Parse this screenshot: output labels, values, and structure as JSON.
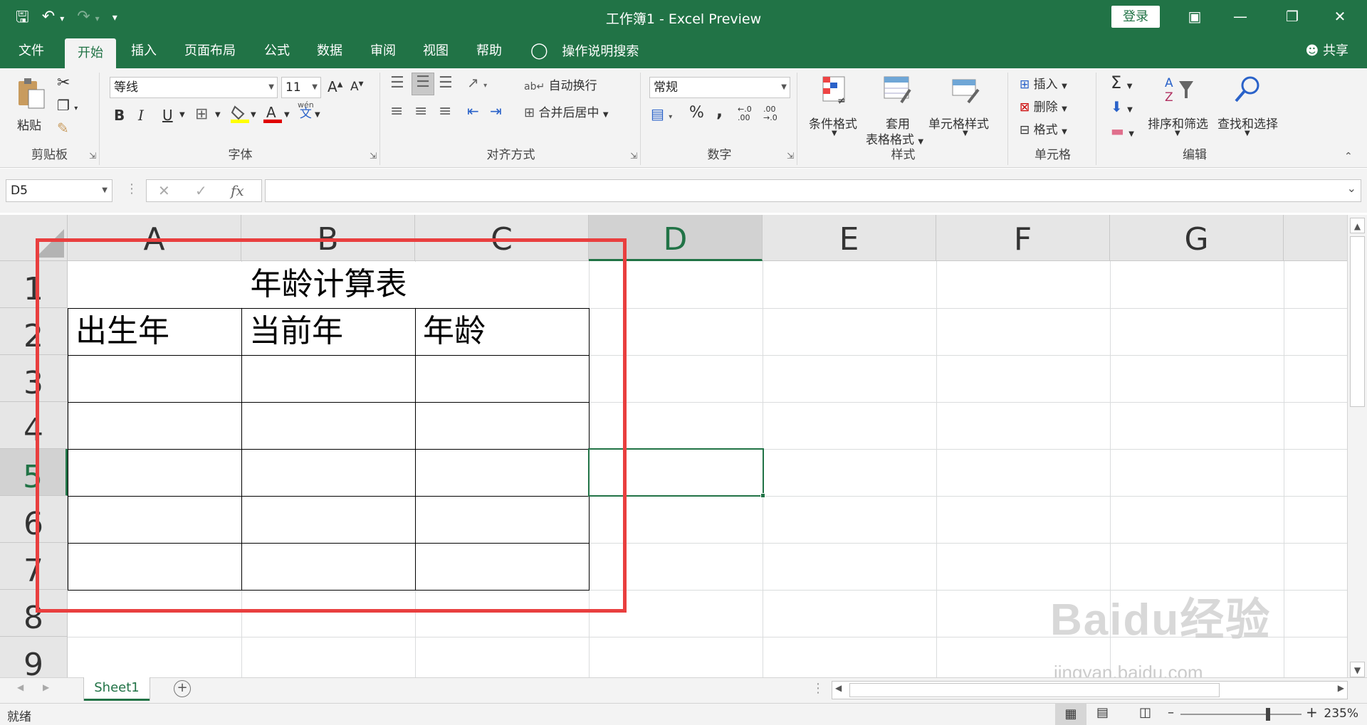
{
  "titlebar": {
    "title": "工作簿1  -  Excel Preview",
    "login": "登录",
    "save_icon": "save-icon",
    "undo_icon": "undo-icon",
    "redo_icon": "redo-icon"
  },
  "tabs": {
    "items": [
      "文件",
      "开始",
      "插入",
      "页面布局",
      "公式",
      "数据",
      "审阅",
      "视图",
      "帮助"
    ],
    "tell_me": "操作说明搜索",
    "share": "共享"
  },
  "ribbon": {
    "clipboard": {
      "label": "剪贴板",
      "paste": "粘贴"
    },
    "font": {
      "label": "字体",
      "font_name": "等线",
      "font_size": "11",
      "bold": "B",
      "italic": "I",
      "underline": "U",
      "increase": "A",
      "decrease": "A",
      "wen": "wén",
      "wen_char": "文"
    },
    "alignment": {
      "label": "对齐方式",
      "wrap": "自动换行",
      "merge": "合并后居中"
    },
    "number": {
      "label": "数字",
      "format": "常规",
      "percent": "%",
      "comma": ","
    },
    "styles": {
      "label": "样式",
      "cond": "条件格式",
      "table_1": "套用",
      "table_2": "表格格式",
      "cell_style": "单元格样式"
    },
    "cells": {
      "label": "单元格",
      "insert": "插入",
      "delete": "删除",
      "format": "格式"
    },
    "editing": {
      "label": "编辑",
      "sort": "排序和筛选",
      "find": "查找和选择"
    }
  },
  "formula_bar": {
    "name_box": "D5",
    "value": ""
  },
  "columns": [
    "A",
    "B",
    "C",
    "D",
    "E",
    "F",
    "G"
  ],
  "rows": [
    "1",
    "2",
    "3",
    "4",
    "5",
    "6",
    "7",
    "8",
    "9"
  ],
  "cells": {
    "title": "年龄计算表",
    "a2": "出生年",
    "b2": "当前年",
    "c2": "年龄"
  },
  "sheets": {
    "active": "Sheet1"
  },
  "status": {
    "ready": "就绪",
    "zoom": "235%"
  },
  "watermark": {
    "main": "Baidu经验",
    "sub": "jingyan.baidu.com"
  },
  "colors": {
    "accent": "#217346",
    "highlight_box": "#e93f3f"
  }
}
